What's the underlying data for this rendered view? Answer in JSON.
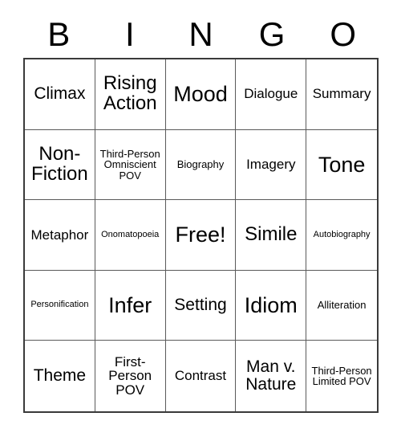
{
  "card": {
    "header_letters": [
      "B",
      "I",
      "N",
      "G",
      "O"
    ],
    "rows": [
      [
        {
          "label": "Climax",
          "size": "sz-md"
        },
        {
          "label": "Rising Action",
          "size": "sz-lg"
        },
        {
          "label": "Mood",
          "size": "sz-xl"
        },
        {
          "label": "Dialogue",
          "size": "sz-sm"
        },
        {
          "label": "Summary",
          "size": "sz-sm"
        }
      ],
      [
        {
          "label": "Non-Fiction",
          "size": "sz-lg"
        },
        {
          "label": "Third-Person Omniscient POV",
          "size": "sz-xs"
        },
        {
          "label": "Biography",
          "size": "sz-xs"
        },
        {
          "label": "Imagery",
          "size": "sz-sm"
        },
        {
          "label": "Tone",
          "size": "sz-xl"
        }
      ],
      [
        {
          "label": "Metaphor",
          "size": "sz-sm"
        },
        {
          "label": "Onomatopoeia",
          "size": "sz-xxs"
        },
        {
          "label": "Free!",
          "size": "sz-xl"
        },
        {
          "label": "Simile",
          "size": "sz-lg"
        },
        {
          "label": "Autobiography",
          "size": "sz-xxs"
        }
      ],
      [
        {
          "label": "Personification",
          "size": "sz-xxs"
        },
        {
          "label": "Infer",
          "size": "sz-xl"
        },
        {
          "label": "Setting",
          "size": "sz-md"
        },
        {
          "label": "Idiom",
          "size": "sz-xl"
        },
        {
          "label": "Alliteration",
          "size": "sz-xs"
        }
      ],
      [
        {
          "label": "Theme",
          "size": "sz-md"
        },
        {
          "label": "First-Person POV",
          "size": "sz-sm"
        },
        {
          "label": "Contrast",
          "size": "sz-sm"
        },
        {
          "label": "Man v. Nature",
          "size": "sz-md"
        },
        {
          "label": "Third-Person Limited POV",
          "size": "sz-xs"
        }
      ]
    ]
  }
}
